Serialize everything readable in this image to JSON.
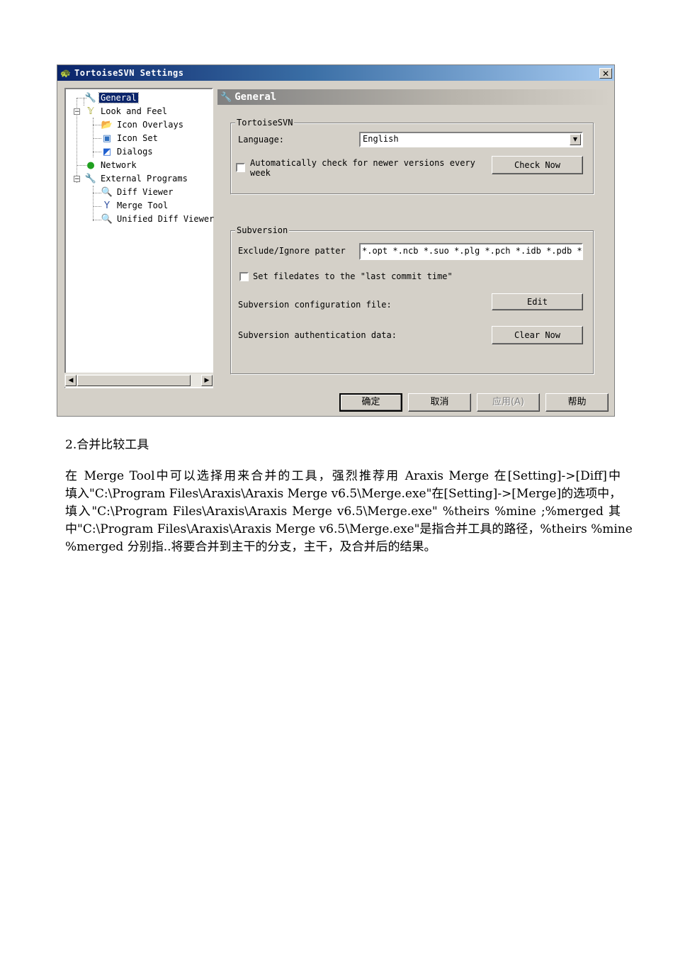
{
  "window": {
    "title": "TortoiseSVN Settings",
    "close_glyph": "✕"
  },
  "tree": {
    "items": [
      {
        "label": "General",
        "icon": "wrench-icon",
        "selected": true
      },
      {
        "label": "Look and Feel",
        "icon": "look-and-feel-icon"
      },
      {
        "label": "Icon Overlays",
        "icon": "icon-overlays-icon"
      },
      {
        "label": "Icon Set",
        "icon": "icon-set-icon"
      },
      {
        "label": "Dialogs",
        "icon": "dialogs-icon"
      },
      {
        "label": "Network",
        "icon": "network-globe-icon"
      },
      {
        "label": "External Programs",
        "icon": "external-programs-icon"
      },
      {
        "label": "Diff Viewer",
        "icon": "magnifier-icon"
      },
      {
        "label": "Merge Tool",
        "icon": "merge-icon"
      },
      {
        "label": "Unified Diff Viewer",
        "icon": "magnifier-icon"
      }
    ]
  },
  "page": {
    "header": "General",
    "tortoise_group": {
      "title": "TortoiseSVN",
      "language_label": "Language:",
      "language_value": "English",
      "auto_check_line1": "Automatically check for newer versions every",
      "auto_check_line2": "week",
      "check_now": "Check Now"
    },
    "subversion_group": {
      "title": "Subversion",
      "exclude_label": "Exclude/Ignore patter",
      "exclude_value": "*.opt *.ncb *.suo *.plg *.pch *.idb *.pdb *",
      "set_filedates": "Set filedates to the \"last commit time\"",
      "config_label": "Subversion configuration file:",
      "edit": "Edit",
      "auth_label": "Subversion authentication data:",
      "clear_now": "Clear Now"
    }
  },
  "buttons": {
    "ok": "确定",
    "cancel": "取消",
    "apply": "应用(A)",
    "help": "帮助"
  },
  "document": {
    "heading": "2.合并比较工具",
    "lines": [
      "在 Merge Tool中可以选择用来合并的工具，强烈推荐用 Araxis Merge 在[Setting]->[Diff]中",
      "填入\"C:\\Program Files\\Araxis\\Araxis Merge v6.5\\Merge.exe\"在[Setting]->[Merge]的选项中，",
      "填入\"C:\\Program Files\\Araxis\\Araxis Merge v6.5\\Merge.exe\" %theirs %mine ;%merged 其",
      "中\"C:\\Program Files\\Araxis\\Araxis Merge v6.5\\Merge.exe\"是指合并工具的路径，%theirs %mine",
      "%merged 分别指..将要合并到主干的分支，主干，及合并后的结果。"
    ]
  }
}
